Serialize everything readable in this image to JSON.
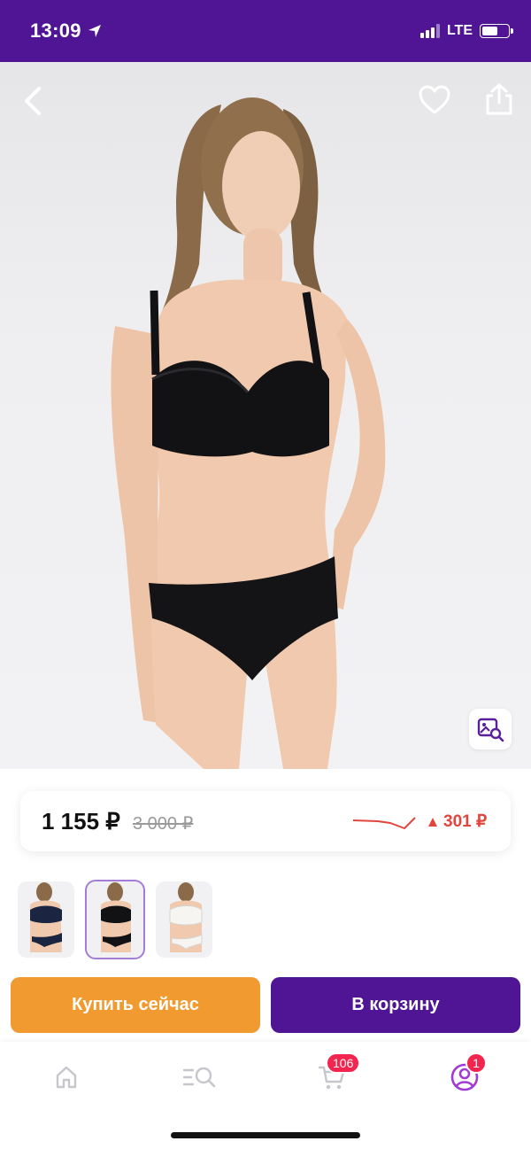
{
  "status_bar": {
    "time": "13:09",
    "network": "LTE",
    "icons": [
      "location-arrow-icon",
      "signal-icon",
      "battery-icon"
    ]
  },
  "product_image": {
    "icons": [
      "back-icon",
      "heart-icon",
      "share-icon",
      "visual-search-icon"
    ]
  },
  "price": {
    "current": "1 155 ₽",
    "old": "3 000 ₽",
    "change": "301 ₽",
    "change_direction": "up",
    "change_color": "#e0463c"
  },
  "thumbnails": [
    {
      "variant": "navy",
      "selected": false
    },
    {
      "variant": "black",
      "selected": true
    },
    {
      "variant": "white",
      "selected": false
    }
  ],
  "actions": {
    "buy_now_label": "Купить сейчас",
    "add_to_cart_label": "В корзину"
  },
  "bottom_nav": {
    "items": [
      {
        "icon": "home-icon"
      },
      {
        "icon": "catalog-search-icon"
      },
      {
        "icon": "cart-icon",
        "badge": "106"
      },
      {
        "icon": "profile-icon",
        "badge": "1",
        "active": true
      }
    ]
  },
  "colors": {
    "brand_purple": "#4f1594",
    "buy_orange": "#f19a2f",
    "badge_red": "#f2254f",
    "profile_accent": "#a23ad6"
  }
}
